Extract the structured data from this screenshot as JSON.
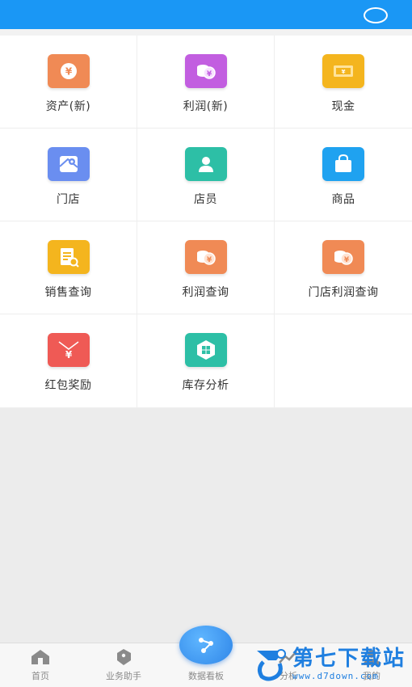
{
  "header": {
    "background": "#1a97f5"
  },
  "grid": [
    {
      "label": "资产(新)",
      "icon": "yen-wallet-icon",
      "color": "#f08a55"
    },
    {
      "label": "利润(新)",
      "icon": "coins-yen-icon",
      "color": "#c25ee0"
    },
    {
      "label": "现金",
      "icon": "cash-note-icon",
      "color": "#f4b51e"
    },
    {
      "label": "门店",
      "icon": "map-pin-icon",
      "color": "#6a8ef0"
    },
    {
      "label": "店员",
      "icon": "person-icon",
      "color": "#2dbfa6"
    },
    {
      "label": "商品",
      "icon": "shopping-bag-icon",
      "color": "#1fa2f0"
    },
    {
      "label": "销售查询",
      "icon": "sales-search-icon",
      "color": "#f4b51e"
    },
    {
      "label": "利润查询",
      "icon": "coins-yen-icon",
      "color": "#f08a55"
    },
    {
      "label": "门店利润查询",
      "icon": "coins-yen-icon",
      "color": "#f08a55"
    },
    {
      "label": "红包奖励",
      "icon": "red-envelope-icon",
      "color": "#ef5a55"
    },
    {
      "label": "库存分析",
      "icon": "inventory-box-icon",
      "color": "#2dbfa6"
    }
  ],
  "bottom_nav": {
    "home": "首页",
    "assistant": "业务助手",
    "dashboard": "数据看板",
    "analysis": "分析",
    "mine": "我的"
  },
  "watermark": {
    "main": "第七下载站",
    "sub": "www.d7down.com"
  }
}
